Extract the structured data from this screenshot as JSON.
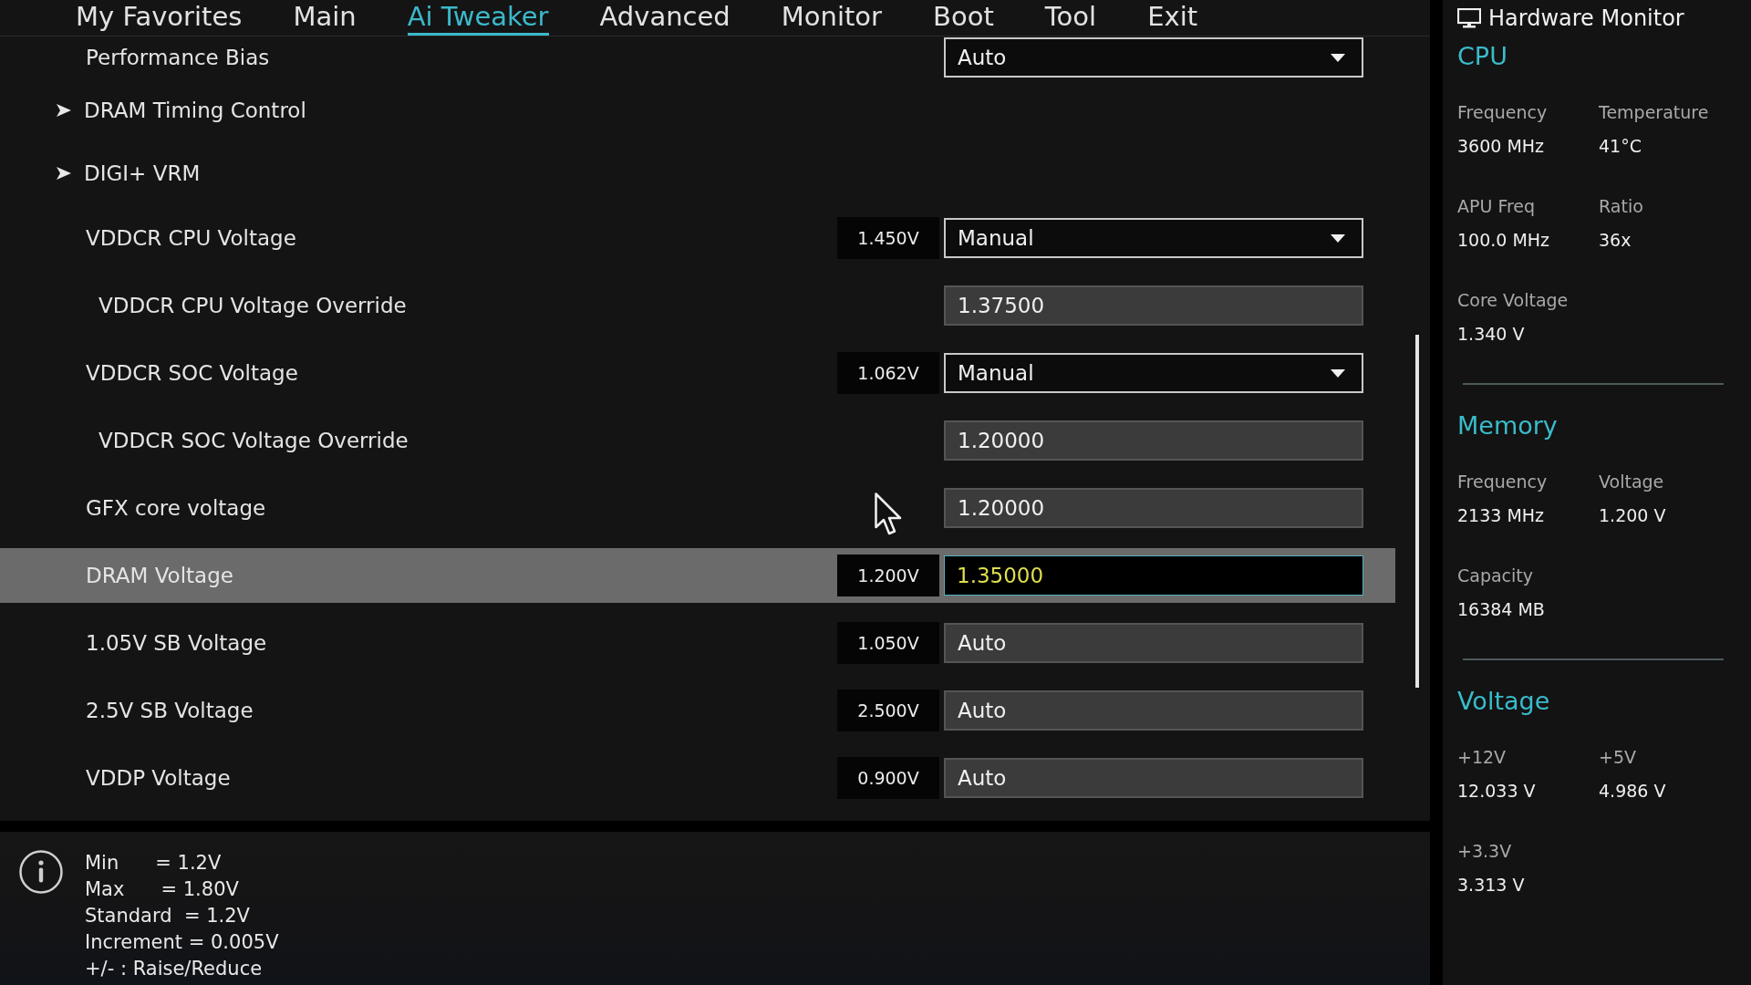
{
  "tabs": [
    {
      "label": "My Favorites",
      "selected": false
    },
    {
      "label": "Main",
      "selected": false
    },
    {
      "label": "Ai Tweaker",
      "selected": true
    },
    {
      "label": "Advanced",
      "selected": false
    },
    {
      "label": "Monitor",
      "selected": false
    },
    {
      "label": "Boot",
      "selected": false
    },
    {
      "label": "Tool",
      "selected": false
    },
    {
      "label": "Exit",
      "selected": false
    }
  ],
  "settings": [
    {
      "kind": "select",
      "label": "Performance Bias",
      "value": "Auto",
      "selected": false
    },
    {
      "kind": "submenu",
      "label": "DRAM Timing Control",
      "selected": false
    },
    {
      "kind": "submenu",
      "label": "DIGI+ VRM",
      "selected": false
    },
    {
      "kind": "select",
      "label": "VDDCR CPU Voltage",
      "reading": "1.450V",
      "value": "Manual",
      "selected": false,
      "children": [
        {
          "kind": "input",
          "label": "VDDCR CPU Voltage Override",
          "value": "1.37500",
          "selected": false
        }
      ]
    },
    {
      "kind": "select",
      "label": "VDDCR SOC Voltage",
      "reading": "1.062V",
      "value": "Manual",
      "selected": false,
      "children": [
        {
          "kind": "input",
          "label": "VDDCR SOC Voltage Override",
          "value": "1.20000",
          "selected": false
        }
      ]
    },
    {
      "kind": "input",
      "label": "GFX core voltage",
      "value": "1.20000",
      "selected": false
    },
    {
      "kind": "input",
      "label": "DRAM Voltage",
      "reading": "1.200V",
      "value": "1.35000",
      "selected": true
    },
    {
      "kind": "input",
      "label": "1.05V SB Voltage",
      "reading": "1.050V",
      "value": "Auto",
      "selected": false
    },
    {
      "kind": "input",
      "label": "2.5V SB Voltage",
      "reading": "2.500V",
      "value": "Auto",
      "selected": false
    },
    {
      "kind": "input",
      "label": "VDDP Voltage",
      "reading": "0.900V",
      "value": "Auto",
      "selected": false
    }
  ],
  "info": {
    "lines": [
      "Min      = 1.2V",
      "Max      = 1.80V",
      "Standard  = 1.2V",
      "Increment = 0.005V",
      "+/- : Raise/Reduce"
    ]
  },
  "hardware_monitor": {
    "title": "Hardware Monitor",
    "sections": [
      {
        "title": "CPU",
        "items": [
          {
            "label": "Frequency",
            "value": "3600 MHz"
          },
          {
            "label": "Temperature",
            "value": "41°C"
          },
          {
            "label": "APU Freq",
            "value": "100.0 MHz"
          },
          {
            "label": "Ratio",
            "value": "36x"
          },
          {
            "label": "Core Voltage",
            "value": "1.340 V"
          }
        ]
      },
      {
        "title": "Memory",
        "items": [
          {
            "label": "Frequency",
            "value": "2133 MHz"
          },
          {
            "label": "Voltage",
            "value": "1.200 V"
          },
          {
            "label": "Capacity",
            "value": "16384 MB"
          }
        ]
      },
      {
        "title": "Voltage",
        "items": [
          {
            "label": "+12V",
            "value": "12.033 V"
          },
          {
            "label": "+5V",
            "value": "4.986 V"
          },
          {
            "label": "+3.3V",
            "value": "3.313 V"
          }
        ]
      }
    ]
  }
}
